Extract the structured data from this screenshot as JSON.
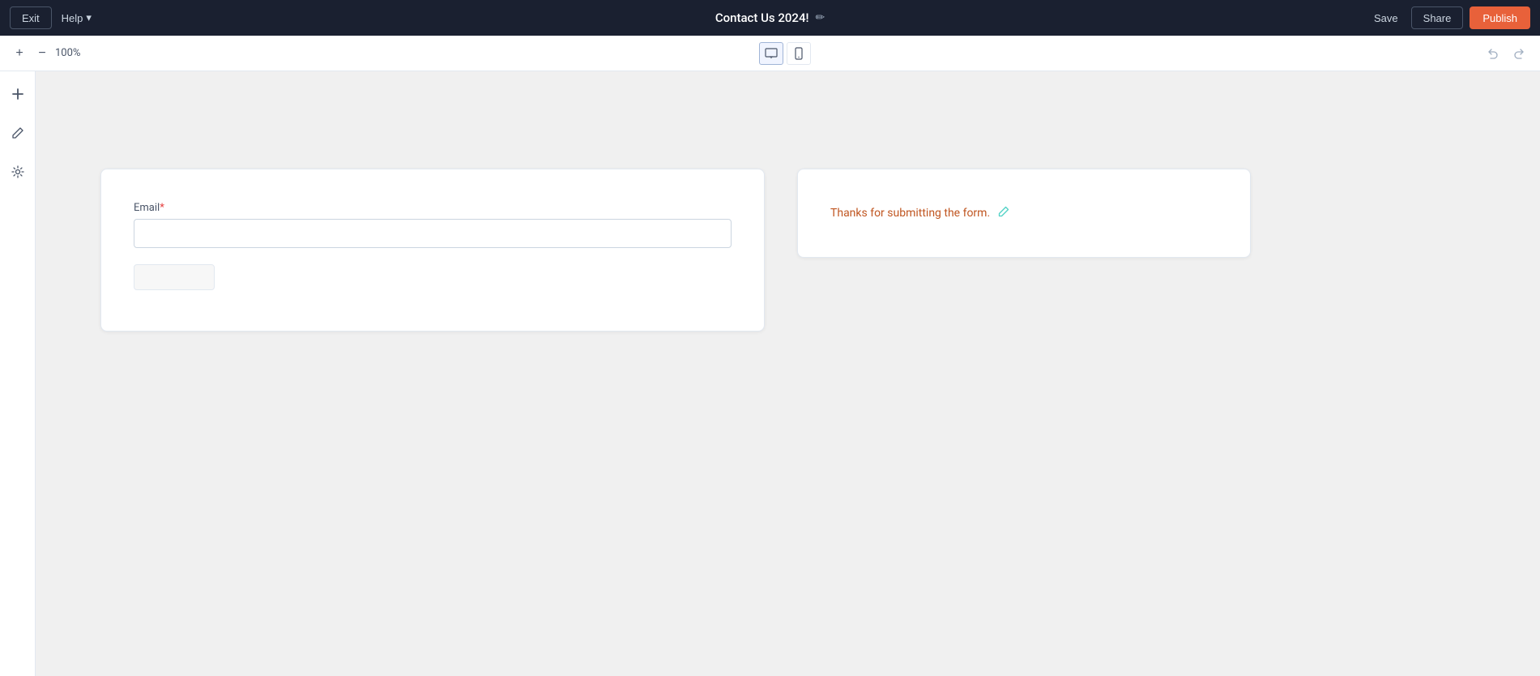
{
  "topbar": {
    "exit_label": "Exit",
    "help_label": "Help",
    "help_chevron": "▾",
    "page_title": "Contact Us 2024!",
    "edit_icon": "✏",
    "save_label": "Save",
    "share_label": "Share",
    "publish_label": "Publish"
  },
  "toolbar": {
    "zoom_minus": "−",
    "zoom_plus": "+",
    "zoom_level": "100%",
    "desktop_icon": "⬜",
    "mobile_icon": "▭",
    "undo_icon": "↩",
    "redo_icon": "↪"
  },
  "sidebar": {
    "add_icon": "+",
    "edit_icon": "✏",
    "settings_icon": "⚙"
  },
  "form_card": {
    "email_label": "Email",
    "email_required": "*",
    "email_placeholder": "",
    "submit_button_label": ""
  },
  "thankyou_card": {
    "message": "Thanks for submitting the form.",
    "edit_icon": "✏"
  }
}
